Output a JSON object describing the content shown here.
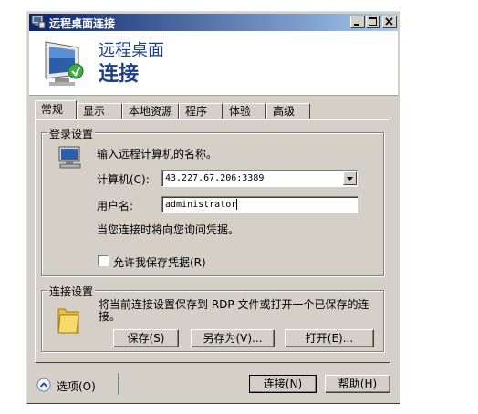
{
  "window": {
    "title": "远程桌面连接",
    "accent": "#0a246a"
  },
  "header": {
    "line1": "远程桌面",
    "line2": "连接"
  },
  "tabs": [
    {
      "label": "常规",
      "active": true
    },
    {
      "label": "显示"
    },
    {
      "label": "本地资源"
    },
    {
      "label": "程序"
    },
    {
      "label": "体验"
    },
    {
      "label": "高级"
    }
  ],
  "login": {
    "legend": "登录设置",
    "prompt": "输入远程计算机的名称。",
    "computer_label": "计算机(C):",
    "computer_value": "43.227.67.206:3389",
    "user_label": "用户名:",
    "user_value": "administrator",
    "note": "当您连接时将向您询问凭据。",
    "save_creds_label": "允许我保存凭据(R)"
  },
  "connection": {
    "legend": "连接设置",
    "desc": "将当前连接设置保存到 RDP 文件或打开一个已保存的连接。",
    "save": "保存(S)",
    "save_as": "另存为(V)...",
    "open": "打开(E)..."
  },
  "footer": {
    "options": "选项(O)",
    "connect": "连接(N)",
    "help": "帮助(H)"
  },
  "icons": {
    "app": "remote-desktop-icon",
    "monitor": "monitor-connect-icon",
    "folder": "folder-icon",
    "options_toggle": "chevron-up-icon"
  }
}
